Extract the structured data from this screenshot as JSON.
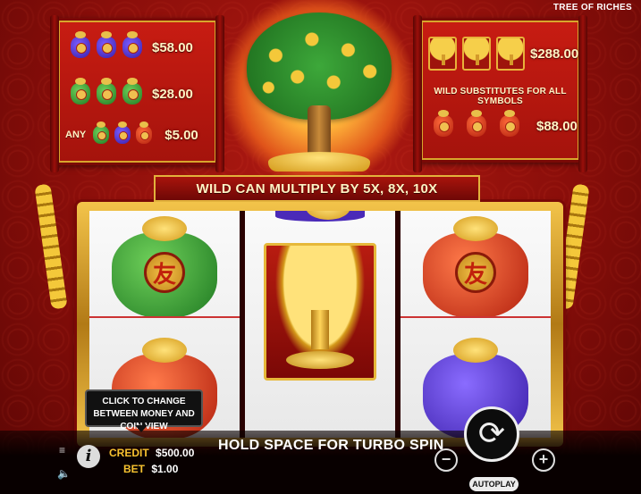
{
  "game": {
    "title": "TREE OF RICHES"
  },
  "paytable_left": {
    "rows": [
      {
        "symbol": "purple-bag",
        "value": "$58.00"
      },
      {
        "symbol": "green-bag",
        "value": "$28.00"
      },
      {
        "label": "ANY",
        "symbol": "mixed-bags",
        "value": "$5.00"
      }
    ]
  },
  "paytable_right": {
    "wild_value": "$288.00",
    "wild_note": "WILD SUBSTITUTES FOR ALL SYMBOLS",
    "red_value": "$88.00"
  },
  "banner": {
    "text": "WILD CAN MULTIPLY BY 5X, 8X, 10X"
  },
  "reels": {
    "columns": [
      {
        "top": "green-bag",
        "bottom": "red-bag"
      },
      {
        "top": "purple-bag-partial",
        "middle": "wild-tree"
      },
      {
        "top": "red-bag",
        "bottom": "purple-bag"
      }
    ],
    "emblem_char": "友"
  },
  "tooltip": {
    "text": "CLICK TO CHANGE BETWEEN MONEY AND COIN VIEW"
  },
  "status": {
    "credit_label": "CREDIT",
    "credit_value": "$500.00",
    "bet_label": "BET",
    "bet_value": "$1.00",
    "message": "HOLD SPACE FOR TURBO SPIN"
  },
  "controls": {
    "minus": "−",
    "plus": "+",
    "spin": "⟳",
    "autoplay": "AUTOPLAY",
    "menu": "≡",
    "info": "i",
    "sound": "🔈"
  },
  "colors": {
    "accent_gold": "#f6c230",
    "background_red": "#8a0e0a"
  }
}
